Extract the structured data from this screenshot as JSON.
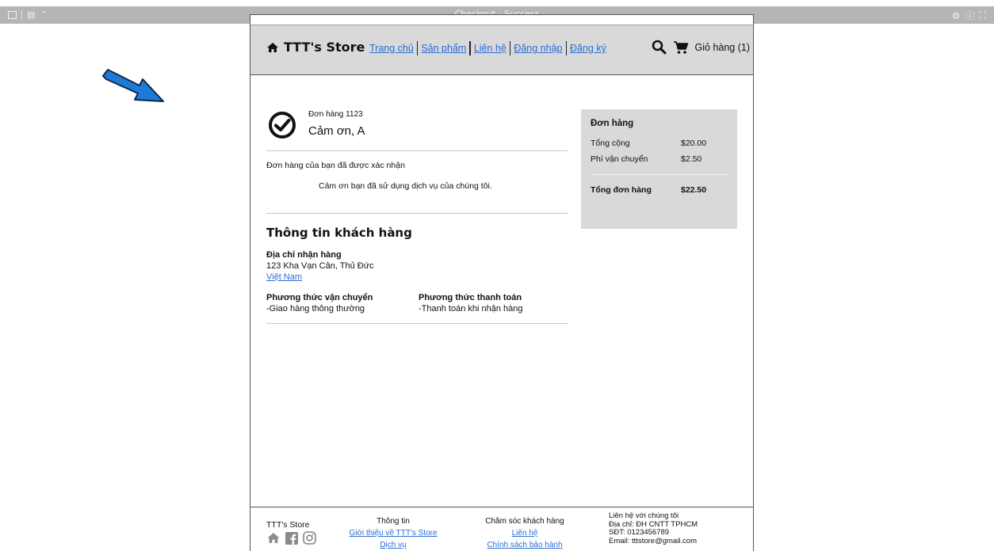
{
  "viewer": {
    "title": "Checkout - Success"
  },
  "header": {
    "brand": "TTT's Store",
    "nav": [
      {
        "label": "Trang chủ"
      },
      {
        "label": "Sản phẩm"
      },
      {
        "label": "Liên hệ"
      },
      {
        "label": "Đăng nhập"
      },
      {
        "label": "Đăng ký"
      }
    ],
    "cart_label": "Giỏ hàng (1)"
  },
  "confirmation": {
    "order_no": "Đơn hàng 1123",
    "thanks_name": "Cảm ơn, A",
    "confirmed": "Đơn hàng của bạn đã được xác nhận",
    "thanks_service": "Cảm ơn bạn đã sử dụng dịch vụ của chúng tôi."
  },
  "customer": {
    "title": "Thông tin khách hàng",
    "address_label": "Địa chỉ nhận hàng",
    "address": "123 Kha Vạn Cân, Thủ Đức",
    "country": "Việt Nam",
    "shipping_label": "Phương thức vận chuyển",
    "shipping_value": "-Giao hàng thông thường",
    "payment_label": "Phương thức thanh toán",
    "payment_value": "-Thanh toán khi nhận hàng"
  },
  "summary": {
    "title": "Đơn hàng",
    "subtotal_label": "Tổng cộng",
    "subtotal_value": "$20.00",
    "shipping_label": "Phí vận chuyển",
    "shipping_value": "$2.50",
    "total_label": "Tổng đơn hàng",
    "total_value": "$22.50"
  },
  "footer": {
    "store": "TTT's Store",
    "info_title": "Thông tin",
    "info_links": [
      "Giới thiệu về TTT's Store",
      "Dịch vụ"
    ],
    "care_title": "Chăm sóc khách hàng",
    "care_links": [
      "Liên hệ",
      "Chính sách bảo hành"
    ],
    "contact_title": "Liên hệ với chúng tôi",
    "contact_address": "Địa chỉ: ĐH CNTT TPHCM",
    "contact_phone": "SĐT: 0123456789",
    "contact_email": "Email: tttstore@gmail.com"
  },
  "colors": {
    "link": "#2b6cd4",
    "panel": "#d9d9d9",
    "arrow": "#1f7ad6"
  }
}
